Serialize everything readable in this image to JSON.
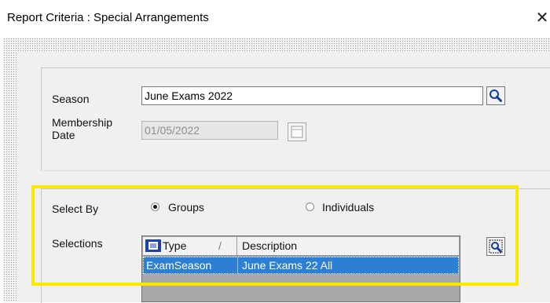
{
  "window": {
    "title": "Report Criteria : Special Arrangements",
    "close_glyph": "✕"
  },
  "criteria": {
    "season_label": "Season",
    "season_value": "June Exams 2022",
    "membership_label_line1": "Membership",
    "membership_label_line2": "Date",
    "membership_date_value": "01/05/2022"
  },
  "select_by": {
    "label": "Select By",
    "options": [
      {
        "label": "Groups",
        "selected": true
      },
      {
        "label": "Individuals",
        "selected": false
      }
    ]
  },
  "selections": {
    "label": "Selections",
    "columns": [
      "Type",
      "Description"
    ],
    "sort_indicator": "/",
    "rows": [
      {
        "type": "ExamSeason",
        "description": "June Exams 22 All",
        "selected": true
      }
    ]
  },
  "colors": {
    "highlight_border": "#ffe800",
    "row_selected": "#2d7fd3"
  },
  "icons": {
    "season_lookup": "magnifier-icon",
    "date_picker": "calendar-icon",
    "selections_lookup": "magnifier-icon",
    "column_type": "grid-column-icon"
  }
}
